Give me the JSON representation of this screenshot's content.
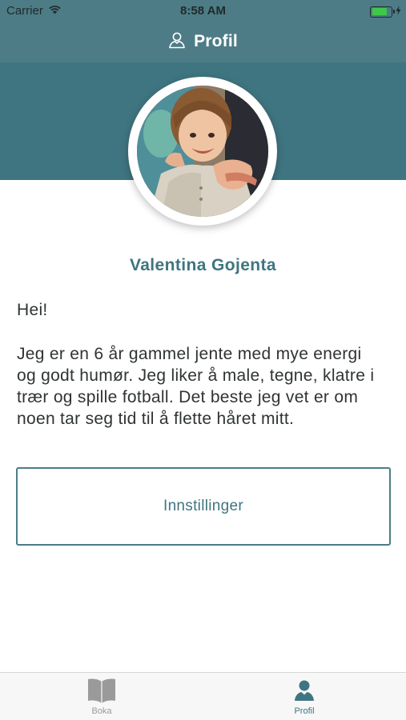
{
  "status_bar": {
    "carrier": "Carrier",
    "time": "8:58 AM",
    "battery_level": 0.8,
    "icons": [
      "wifi-icon",
      "battery-icon",
      "charging-bolt-icon"
    ]
  },
  "nav": {
    "title": "Profil",
    "icon": "user-outline-icon"
  },
  "profile": {
    "name": "Valentina Gojenta",
    "greeting": "Hei!",
    "bio_lines": [
      "Jeg er en 6 år gammel jente med mye energi",
      "og godt humør. Jeg liker å male, tegne, klatre i",
      "trær og spille fotball. Det beste jeg vet er om",
      "noen tar seg tid til å flette håret mitt."
    ]
  },
  "actions": {
    "settings_label": "Innstillinger"
  },
  "tab_bar": {
    "tabs": [
      {
        "label": "Boka",
        "icon": "book-icon",
        "selected": false
      },
      {
        "label": "Profil",
        "icon": "user-icon",
        "selected": true
      }
    ]
  },
  "colors": {
    "nav_background": "#4d7c86",
    "header_band": "#3f7580",
    "accent": "#3f7580",
    "text": "#2f3334"
  }
}
